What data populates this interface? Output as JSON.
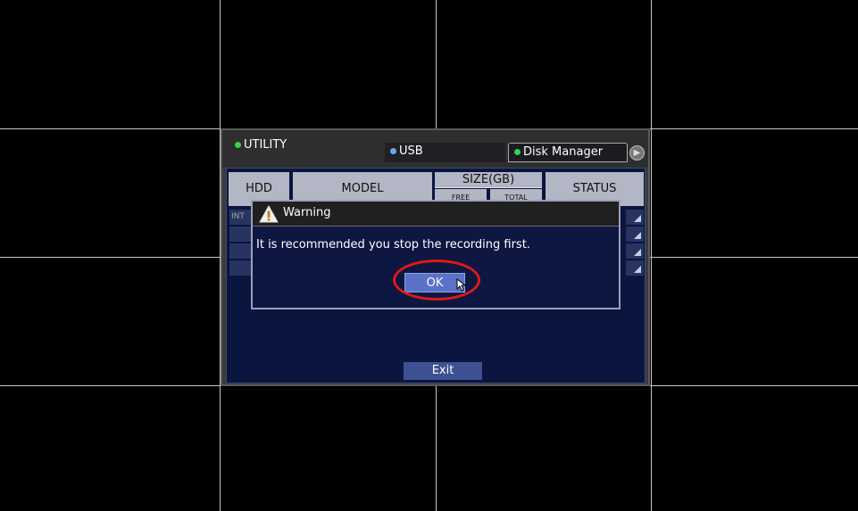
{
  "utility": {
    "title": "UTILITY",
    "tabs": [
      {
        "label": "USB"
      },
      {
        "label": "Disk Manager"
      }
    ]
  },
  "table": {
    "headers": {
      "hdd": "HDD",
      "model": "MODEL",
      "size": "SIZE(GB)",
      "free": "FREE",
      "total": "TOTAL",
      "status": "STATUS"
    },
    "first_row_hdd": "INT"
  },
  "exit_label": "Exit",
  "dialog": {
    "title": "Warning",
    "message": "It is recommended you stop the recording first.",
    "ok_label": "OK"
  },
  "colors": {
    "accent": "#5b72c8",
    "panel": "#0a1640",
    "highlight": "#e11818",
    "indicator_active": "#35d24a",
    "indicator_inactive": "#6aa8e8"
  },
  "icons": {
    "dialog": "warning-icon",
    "pointer": "mouse-cursor-icon",
    "tab_next": "arrow-right-icon"
  }
}
